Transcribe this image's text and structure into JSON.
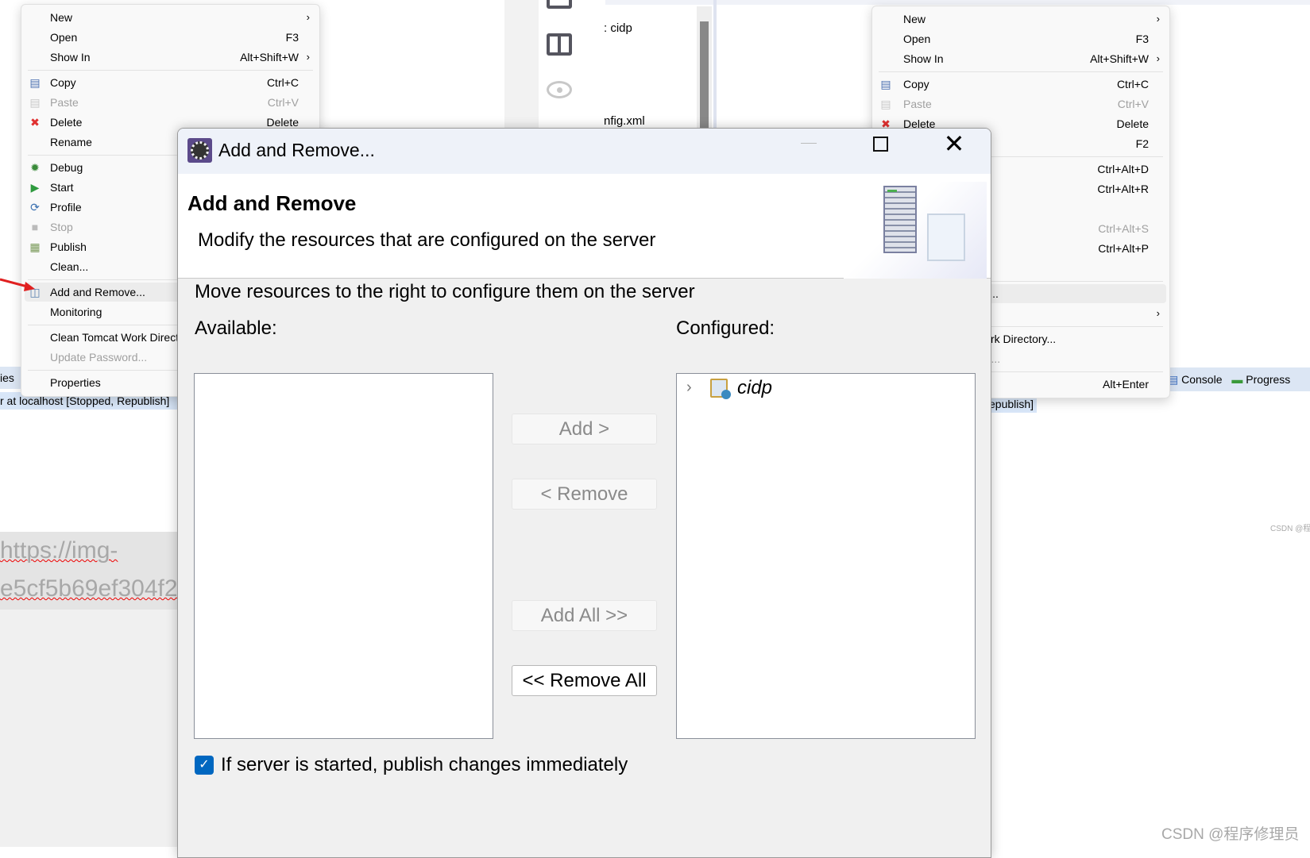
{
  "context_menu": {
    "items": [
      {
        "label": "New",
        "shortcut": "",
        "submenu": true,
        "icon": "",
        "disabled": false
      },
      {
        "label": "Open",
        "shortcut": "F3",
        "submenu": false,
        "icon": "",
        "disabled": false
      },
      {
        "label": "Show In",
        "shortcut": "Alt+Shift+W",
        "submenu": true,
        "icon": "",
        "disabled": false,
        "sep_after": true
      },
      {
        "label": "Copy",
        "shortcut": "Ctrl+C",
        "submenu": false,
        "icon": "copy-icon",
        "disabled": false
      },
      {
        "label": "Paste",
        "shortcut": "Ctrl+V",
        "submenu": false,
        "icon": "paste-icon",
        "disabled": true
      },
      {
        "label": "Delete",
        "shortcut": "Delete",
        "submenu": false,
        "icon": "delete-icon",
        "disabled": false
      },
      {
        "label": "Rename",
        "shortcut": "F2",
        "submenu": false,
        "icon": "",
        "disabled": false,
        "sep_after": true
      },
      {
        "label": "Debug",
        "shortcut": "Ctrl+Alt+D",
        "submenu": false,
        "icon": "debug-icon",
        "disabled": false
      },
      {
        "label": "Start",
        "shortcut": "Ctrl+Alt+R",
        "submenu": false,
        "icon": "start-icon",
        "disabled": false
      },
      {
        "label": "Profile",
        "shortcut": "",
        "submenu": false,
        "icon": "profile-icon",
        "disabled": false
      },
      {
        "label": "Stop",
        "shortcut": "Ctrl+Alt+S",
        "submenu": false,
        "icon": "stop-icon",
        "disabled": true
      },
      {
        "label": "Publish",
        "shortcut": "Ctrl+Alt+P",
        "submenu": false,
        "icon": "publish-icon",
        "disabled": false
      },
      {
        "label": "Clean...",
        "shortcut": "",
        "submenu": false,
        "icon": "",
        "disabled": false,
        "sep_after": true
      },
      {
        "label": "Add and Remove...",
        "shortcut": "",
        "submenu": false,
        "icon": "add-remove-icon",
        "disabled": false,
        "highlighted": true
      },
      {
        "label": "Monitoring",
        "shortcut": "",
        "submenu": true,
        "icon": "",
        "disabled": false,
        "sep_after": true
      },
      {
        "label": "Clean Tomcat Work Directory...",
        "shortcut": "",
        "submenu": false,
        "icon": "",
        "disabled": false
      },
      {
        "label": "Update Password...",
        "shortcut": "",
        "submenu": false,
        "icon": "",
        "disabled": true,
        "sep_after": true
      },
      {
        "label": "Properties",
        "shortcut": "Alt+Enter",
        "submenu": false,
        "icon": "",
        "disabled": false
      }
    ]
  },
  "background": {
    "tab_left": "ies",
    "server_row": "r at localhost  [Stopped, Republish]",
    "server_row_right": "epublish]",
    "editor_line1": ": cidp",
    "editor_line2": "nfig.xml",
    "url_line1": "https://img-",
    "url_line2": "e5cf5b69ef304f29",
    "tabs_right": [
      "Console",
      "Progress"
    ],
    "watermark_small": "CSDN @程",
    "watermark": "CSDN @程序修理员"
  },
  "dialog": {
    "window_title": "Add and Remove...",
    "header_title": "Add and Remove",
    "header_desc": "Modify the resources that are configured on the server",
    "instruction": "Move resources to the right to configure them on the server",
    "available_label": "Available:",
    "configured_label": "Configured:",
    "available_items": [],
    "configured_items": [
      {
        "name": "cidp",
        "icon": "web-module-icon"
      }
    ],
    "buttons": {
      "add": "Add >",
      "remove": "< Remove",
      "add_all": "Add All >>",
      "remove_all": "<< Remove All"
    },
    "publish_checkbox": {
      "label": "If server is started, publish changes immediately",
      "checked": true
    },
    "colors": {
      "checkbox": "#0067c0",
      "accent_red": "#e02020"
    }
  }
}
